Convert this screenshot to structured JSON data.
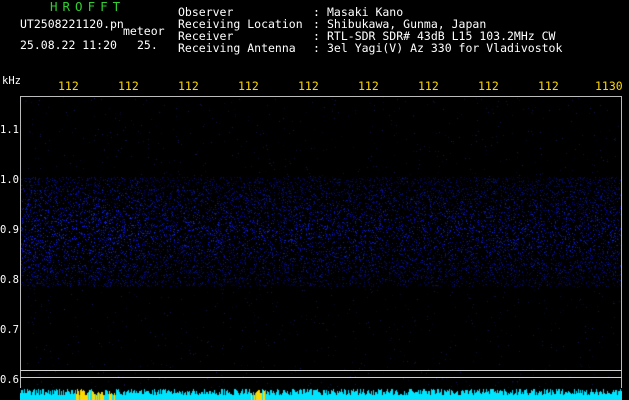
{
  "header": {
    "app_title": "HROFFT",
    "file_name": "UT2508221120.pn",
    "subtitle_word": "meteor",
    "date_time": "25.08.22 11:20",
    "value_25": "25.",
    "info": [
      {
        "label": "Observer",
        "value": "Masaki Kano"
      },
      {
        "label": "Receiving Location",
        "value": "Shibukawa, Gunma, Japan"
      },
      {
        "label": "Receiver",
        "value": "RTL-SDR SDR# 43dB L15 103.2MHz CW"
      },
      {
        "label": "Receiving Antenna",
        "value": "3el Yagi(V) Az 330 for Vladivostok"
      }
    ]
  },
  "axes": {
    "y_unit": "kHz",
    "y_ticks": [
      "1.1",
      "1.0",
      "0.9",
      "0.8",
      "0.7",
      "0.6"
    ],
    "x_ticks": [
      "112",
      "112",
      "112",
      "112",
      "112",
      "112",
      "112",
      "112",
      "112",
      "1130"
    ]
  },
  "colors": {
    "title_green": "#2fd02f",
    "tick_yellow": "#ffd800",
    "signal_blue": "#2030ff",
    "strip_cyan": "#00e5ff"
  }
}
